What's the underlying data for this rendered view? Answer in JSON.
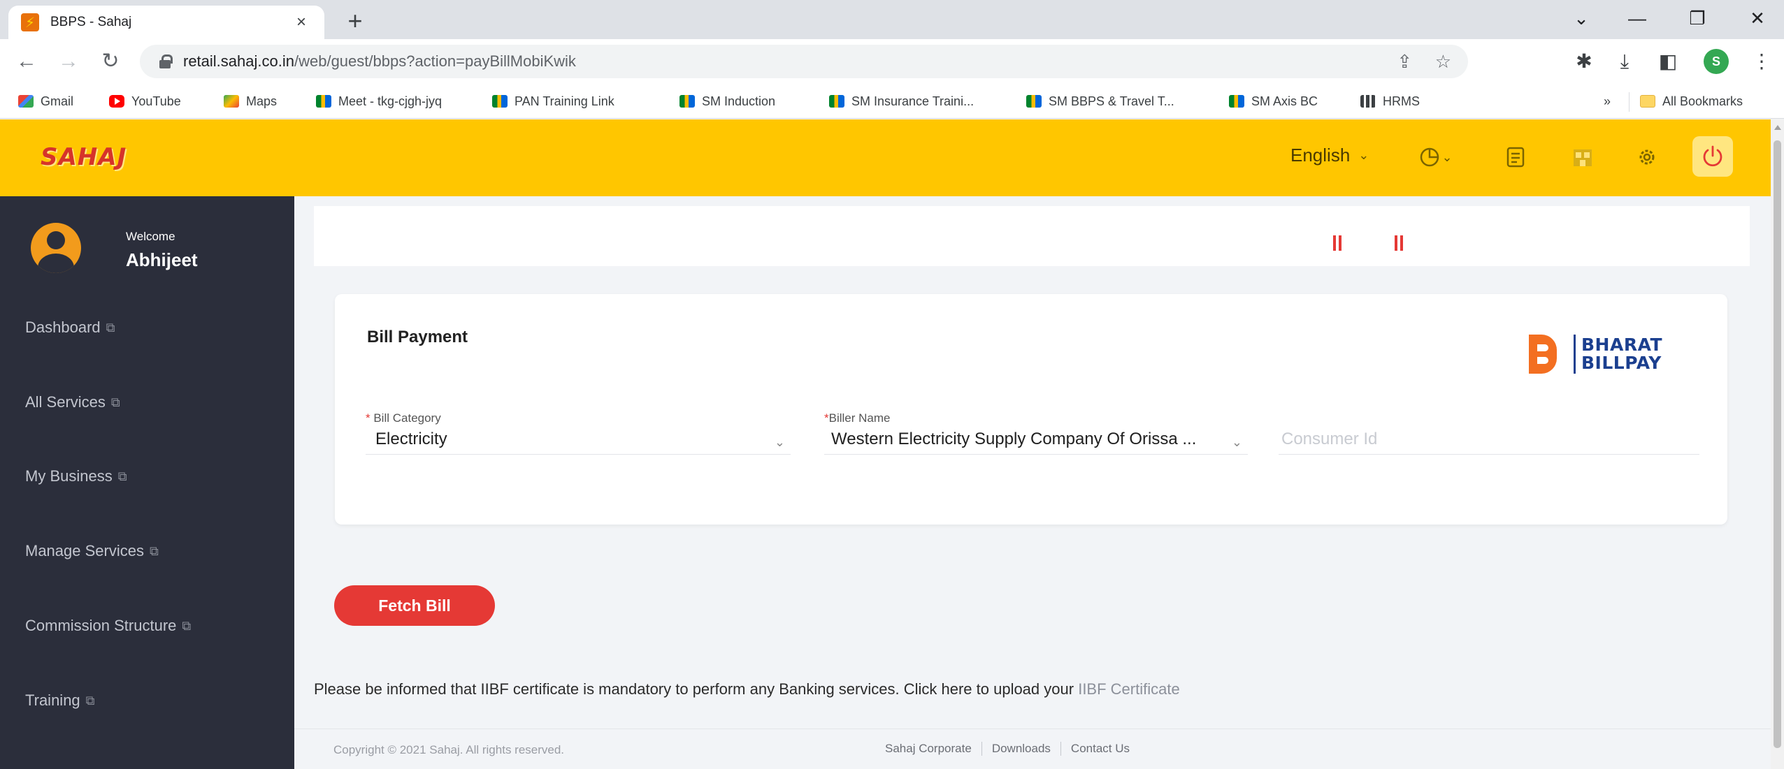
{
  "browser": {
    "tab_title": "BBPS - Sahaj",
    "tab_close": "×",
    "new_tab": "+",
    "url_host": "retail.sahaj.co.in",
    "url_path": "/web/guest/bbps?action=payBillMobiKwik",
    "window_controls": {
      "tab_search": "⌄",
      "minimize": "—",
      "restore": "❐",
      "close": "✕"
    }
  },
  "bookmarks": {
    "items": [
      {
        "label": "Gmail",
        "icon": "gmail-icon"
      },
      {
        "label": "YouTube",
        "icon": "youtube-icon"
      },
      {
        "label": "Maps",
        "icon": "maps-icon"
      },
      {
        "label": "Meet - tkg-cjgh-jyq",
        "icon": "meet-icon"
      },
      {
        "label": "PAN Training Link",
        "icon": "meet-icon"
      },
      {
        "label": "SM Induction",
        "icon": "meet-icon"
      },
      {
        "label": "SM Insurance Traini...",
        "icon": "meet-icon"
      },
      {
        "label": "SM BBPS & Travel T...",
        "icon": "meet-icon"
      },
      {
        "label": "SM Axis BC",
        "icon": "meet-icon"
      },
      {
        "label": "HRMS",
        "icon": "hrms-icon"
      }
    ],
    "overflow": "»",
    "all_bookmarks": "All Bookmarks"
  },
  "header": {
    "logo_text": "SAHAJ",
    "language": "English"
  },
  "sidebar": {
    "welcome": "Welcome",
    "username": "Abhijeet",
    "items": [
      {
        "label": "Dashboard"
      },
      {
        "label": "All Services"
      },
      {
        "label": "My Business"
      },
      {
        "label": "Manage Services"
      },
      {
        "label": "Commission Structure"
      },
      {
        "label": "Training"
      }
    ]
  },
  "bill_payment": {
    "title": "Bill Payment",
    "logo_line1": "BHARAT",
    "logo_line2": "BILLPAY",
    "category_label": "Bill Category",
    "category_value": "Electricity",
    "biller_label": "Biller Name",
    "biller_value": "Western Electricity Supply Company Of Orissa ...",
    "consumer_placeholder": "Consumer Id",
    "fetch_button": "Fetch Bill"
  },
  "notice": {
    "text": "Please be informed that IIBF certificate is mandatory to perform any Banking services. Click here to upload your",
    "link": "IIBF Certificate"
  },
  "footer": {
    "copyright": "Copyright © 2021 Sahaj. All rights reserved.",
    "links": [
      "Sahaj Corporate",
      "Downloads",
      "Contact Us"
    ]
  },
  "colors": {
    "brand_yellow": "#ffc600",
    "sidebar_bg": "#2b2e3b",
    "accent_red": "#e53935",
    "bbps_orange": "#f36f21",
    "bbps_blue": "#1b3f8f"
  }
}
